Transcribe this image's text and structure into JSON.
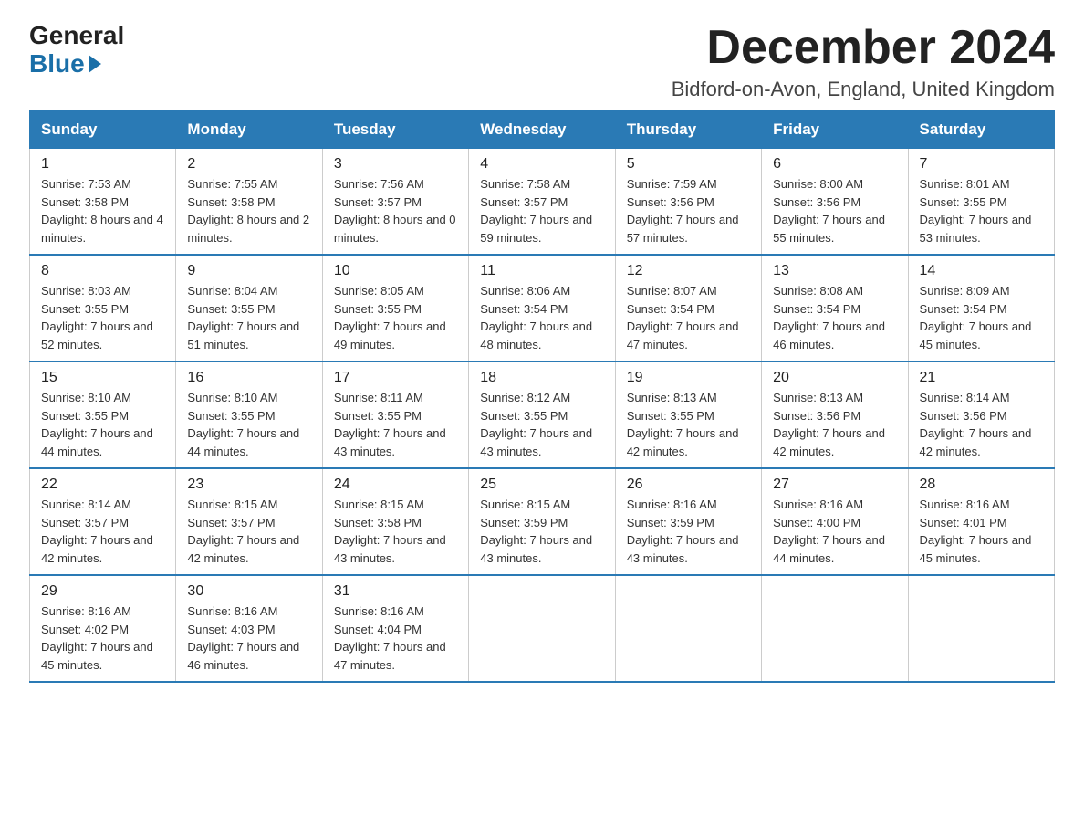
{
  "header": {
    "logo_general": "General",
    "logo_blue": "Blue",
    "month_title": "December 2024",
    "location": "Bidford-on-Avon, England, United Kingdom"
  },
  "weekdays": [
    "Sunday",
    "Monday",
    "Tuesday",
    "Wednesday",
    "Thursday",
    "Friday",
    "Saturday"
  ],
  "weeks": [
    [
      {
        "day": "1",
        "sunrise": "Sunrise: 7:53 AM",
        "sunset": "Sunset: 3:58 PM",
        "daylight": "Daylight: 8 hours and 4 minutes."
      },
      {
        "day": "2",
        "sunrise": "Sunrise: 7:55 AM",
        "sunset": "Sunset: 3:58 PM",
        "daylight": "Daylight: 8 hours and 2 minutes."
      },
      {
        "day": "3",
        "sunrise": "Sunrise: 7:56 AM",
        "sunset": "Sunset: 3:57 PM",
        "daylight": "Daylight: 8 hours and 0 minutes."
      },
      {
        "day": "4",
        "sunrise": "Sunrise: 7:58 AM",
        "sunset": "Sunset: 3:57 PM",
        "daylight": "Daylight: 7 hours and 59 minutes."
      },
      {
        "day": "5",
        "sunrise": "Sunrise: 7:59 AM",
        "sunset": "Sunset: 3:56 PM",
        "daylight": "Daylight: 7 hours and 57 minutes."
      },
      {
        "day": "6",
        "sunrise": "Sunrise: 8:00 AM",
        "sunset": "Sunset: 3:56 PM",
        "daylight": "Daylight: 7 hours and 55 minutes."
      },
      {
        "day": "7",
        "sunrise": "Sunrise: 8:01 AM",
        "sunset": "Sunset: 3:55 PM",
        "daylight": "Daylight: 7 hours and 53 minutes."
      }
    ],
    [
      {
        "day": "8",
        "sunrise": "Sunrise: 8:03 AM",
        "sunset": "Sunset: 3:55 PM",
        "daylight": "Daylight: 7 hours and 52 minutes."
      },
      {
        "day": "9",
        "sunrise": "Sunrise: 8:04 AM",
        "sunset": "Sunset: 3:55 PM",
        "daylight": "Daylight: 7 hours and 51 minutes."
      },
      {
        "day": "10",
        "sunrise": "Sunrise: 8:05 AM",
        "sunset": "Sunset: 3:55 PM",
        "daylight": "Daylight: 7 hours and 49 minutes."
      },
      {
        "day": "11",
        "sunrise": "Sunrise: 8:06 AM",
        "sunset": "Sunset: 3:54 PM",
        "daylight": "Daylight: 7 hours and 48 minutes."
      },
      {
        "day": "12",
        "sunrise": "Sunrise: 8:07 AM",
        "sunset": "Sunset: 3:54 PM",
        "daylight": "Daylight: 7 hours and 47 minutes."
      },
      {
        "day": "13",
        "sunrise": "Sunrise: 8:08 AM",
        "sunset": "Sunset: 3:54 PM",
        "daylight": "Daylight: 7 hours and 46 minutes."
      },
      {
        "day": "14",
        "sunrise": "Sunrise: 8:09 AM",
        "sunset": "Sunset: 3:54 PM",
        "daylight": "Daylight: 7 hours and 45 minutes."
      }
    ],
    [
      {
        "day": "15",
        "sunrise": "Sunrise: 8:10 AM",
        "sunset": "Sunset: 3:55 PM",
        "daylight": "Daylight: 7 hours and 44 minutes."
      },
      {
        "day": "16",
        "sunrise": "Sunrise: 8:10 AM",
        "sunset": "Sunset: 3:55 PM",
        "daylight": "Daylight: 7 hours and 44 minutes."
      },
      {
        "day": "17",
        "sunrise": "Sunrise: 8:11 AM",
        "sunset": "Sunset: 3:55 PM",
        "daylight": "Daylight: 7 hours and 43 minutes."
      },
      {
        "day": "18",
        "sunrise": "Sunrise: 8:12 AM",
        "sunset": "Sunset: 3:55 PM",
        "daylight": "Daylight: 7 hours and 43 minutes."
      },
      {
        "day": "19",
        "sunrise": "Sunrise: 8:13 AM",
        "sunset": "Sunset: 3:55 PM",
        "daylight": "Daylight: 7 hours and 42 minutes."
      },
      {
        "day": "20",
        "sunrise": "Sunrise: 8:13 AM",
        "sunset": "Sunset: 3:56 PM",
        "daylight": "Daylight: 7 hours and 42 minutes."
      },
      {
        "day": "21",
        "sunrise": "Sunrise: 8:14 AM",
        "sunset": "Sunset: 3:56 PM",
        "daylight": "Daylight: 7 hours and 42 minutes."
      }
    ],
    [
      {
        "day": "22",
        "sunrise": "Sunrise: 8:14 AM",
        "sunset": "Sunset: 3:57 PM",
        "daylight": "Daylight: 7 hours and 42 minutes."
      },
      {
        "day": "23",
        "sunrise": "Sunrise: 8:15 AM",
        "sunset": "Sunset: 3:57 PM",
        "daylight": "Daylight: 7 hours and 42 minutes."
      },
      {
        "day": "24",
        "sunrise": "Sunrise: 8:15 AM",
        "sunset": "Sunset: 3:58 PM",
        "daylight": "Daylight: 7 hours and 43 minutes."
      },
      {
        "day": "25",
        "sunrise": "Sunrise: 8:15 AM",
        "sunset": "Sunset: 3:59 PM",
        "daylight": "Daylight: 7 hours and 43 minutes."
      },
      {
        "day": "26",
        "sunrise": "Sunrise: 8:16 AM",
        "sunset": "Sunset: 3:59 PM",
        "daylight": "Daylight: 7 hours and 43 minutes."
      },
      {
        "day": "27",
        "sunrise": "Sunrise: 8:16 AM",
        "sunset": "Sunset: 4:00 PM",
        "daylight": "Daylight: 7 hours and 44 minutes."
      },
      {
        "day": "28",
        "sunrise": "Sunrise: 8:16 AM",
        "sunset": "Sunset: 4:01 PM",
        "daylight": "Daylight: 7 hours and 45 minutes."
      }
    ],
    [
      {
        "day": "29",
        "sunrise": "Sunrise: 8:16 AM",
        "sunset": "Sunset: 4:02 PM",
        "daylight": "Daylight: 7 hours and 45 minutes."
      },
      {
        "day": "30",
        "sunrise": "Sunrise: 8:16 AM",
        "sunset": "Sunset: 4:03 PM",
        "daylight": "Daylight: 7 hours and 46 minutes."
      },
      {
        "day": "31",
        "sunrise": "Sunrise: 8:16 AM",
        "sunset": "Sunset: 4:04 PM",
        "daylight": "Daylight: 7 hours and 47 minutes."
      },
      null,
      null,
      null,
      null
    ]
  ]
}
